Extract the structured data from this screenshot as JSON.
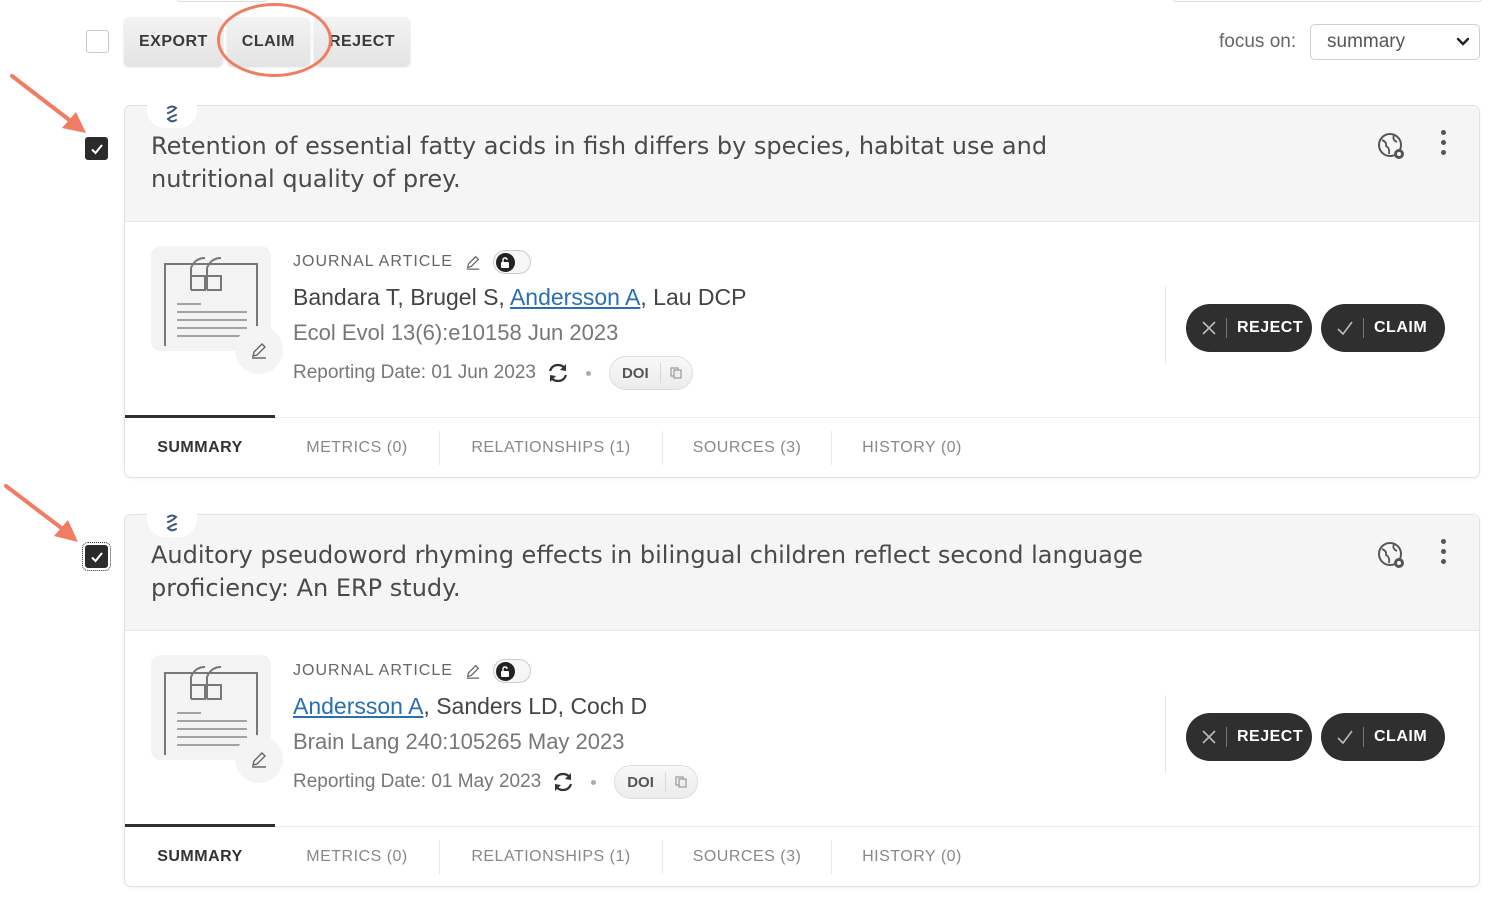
{
  "toolbar": {
    "export_label": "EXPORT",
    "claim_label": "CLAIM",
    "reject_label": "REJECT",
    "select_all_checked": false,
    "focus_label": "focus on:",
    "focus_value": "summary"
  },
  "annotation_color": "#f07c63",
  "records": [
    {
      "checked": true,
      "title": "Retention of essential fatty acids in fish differs by species, habitat use and nutritional quality of prey.",
      "type": "JOURNAL ARTICLE",
      "authors_before": "Bandara T, Brugel S, ",
      "authors_link": "Andersson A",
      "authors_after": ", Lau DCP",
      "journal": "Ecol Evol 13(6):e10158 Jun 2023",
      "reporting_label": "Reporting Date:",
      "reporting_date": "01 Jun 2023",
      "doi_label": "DOI",
      "reject_label": "REJECT",
      "claim_label": "CLAIM",
      "tabs": [
        {
          "label": "SUMMARY",
          "active": true
        },
        {
          "label": "METRICS (0)",
          "active": false
        },
        {
          "label": "RELATIONSHIPS (1)",
          "active": false
        },
        {
          "label": "SOURCES (3)",
          "active": false
        },
        {
          "label": "HISTORY (0)",
          "active": false
        }
      ]
    },
    {
      "checked": true,
      "title": "Auditory pseudoword rhyming effects in bilingual children reflect second language proficiency: An ERP study.",
      "type": "JOURNAL ARTICLE",
      "authors_before": "",
      "authors_link": "Andersson A",
      "authors_after": ", Sanders LD, Coch D",
      "journal": "Brain Lang 240:105265 May 2023",
      "reporting_label": "Reporting Date:",
      "reporting_date": "01 May 2023",
      "doi_label": "DOI",
      "reject_label": "REJECT",
      "claim_label": "CLAIM",
      "tabs": [
        {
          "label": "SUMMARY",
          "active": true
        },
        {
          "label": "METRICS (0)",
          "active": false
        },
        {
          "label": "RELATIONSHIPS (1)",
          "active": false
        },
        {
          "label": "SOURCES (3)",
          "active": false
        },
        {
          "label": "HISTORY (0)",
          "active": false
        }
      ]
    }
  ]
}
